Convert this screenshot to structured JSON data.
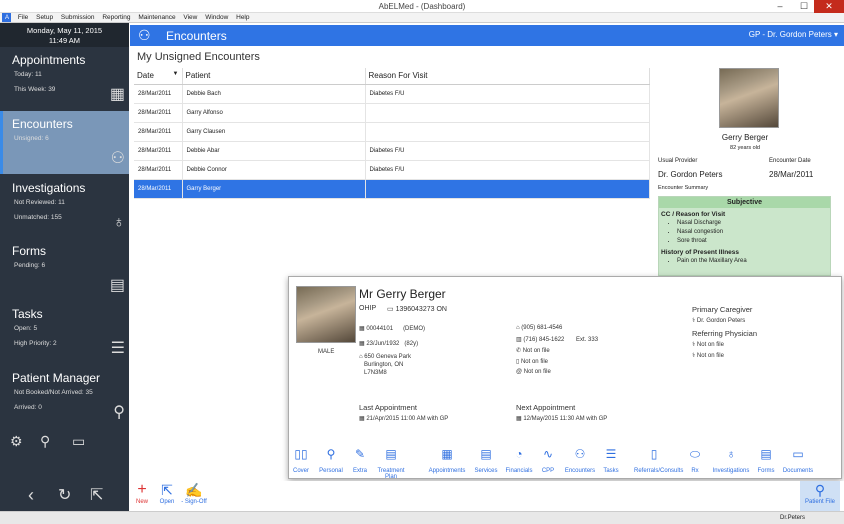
{
  "window": {
    "title": "AbELMed - (Dashboard)",
    "min": "‒",
    "max": "☐",
    "close": "✕"
  },
  "menu": [
    "File",
    "Setup",
    "Submission",
    "Reporting",
    "Maintenance",
    "View",
    "Window",
    "Help"
  ],
  "sidebar": {
    "date": "Monday, May 11, 2015",
    "time": "11:49 AM",
    "sections": [
      {
        "title": "Appointments",
        "l1": "Today: 11",
        "l2": "This Week: 39"
      },
      {
        "title": "Encounters",
        "l1": "Unsigned: 6",
        "l2": ""
      },
      {
        "title": "Investigations",
        "l1": "Not Reviewed: 11",
        "l2": "Unmatched: 155"
      },
      {
        "title": "Forms",
        "l1": "Pending: 6",
        "l2": ""
      },
      {
        "title": "Tasks",
        "l1": "Open: 5",
        "l2": "High Priority: 2"
      },
      {
        "title": "Patient Manager",
        "l1": "Not Booked/Not Arrived: 35",
        "l2": "Arrived: 0"
      }
    ]
  },
  "header": {
    "title": "Encounters",
    "provider": "GP - Dr. Gordon Peters"
  },
  "list": {
    "title": "My Unsigned Encounters",
    "columns": [
      "Date",
      "Patient",
      "Reason For Visit"
    ],
    "rows": [
      {
        "date": "28/Mar/2011",
        "patient": "Debbie Bach",
        "reason": "Diabetes F/U"
      },
      {
        "date": "28/Mar/2011",
        "patient": "Garry Alfonso",
        "reason": ""
      },
      {
        "date": "28/Mar/2011",
        "patient": "Garry Clausen",
        "reason": ""
      },
      {
        "date": "28/Mar/2011",
        "patient": "Debbie Abar",
        "reason": "Diabetes F/U"
      },
      {
        "date": "28/Mar/2011",
        "patient": "Debbie Connor",
        "reason": "Diabetes F/U"
      },
      {
        "date": "28/Mar/2011",
        "patient": "Garry Berger",
        "reason": ""
      }
    ]
  },
  "right": {
    "name": "Gerry Berger",
    "age": "82 years old",
    "usual_provider_label": "Usual Provider",
    "usual_provider": "Dr. Gordon Peters",
    "enc_date_label": "Encounter Date",
    "enc_date": "28/Mar/2011",
    "summary_label": "Encounter Summary",
    "subjective": "Subjective",
    "cc": "CC / Reason for Visit",
    "cc_items": [
      "Nasal Discharge",
      "Nasal congestion",
      "Sore throat"
    ],
    "hpi": "History of Present Illness",
    "hpi_items": [
      "Pain on the Maxillary Area"
    ]
  },
  "popup": {
    "name": "Mr Gerry Berger",
    "sex": "MALE",
    "ohip_label": "OHIP",
    "ohip": "1396043273 ON",
    "chart": "00044101",
    "chart_tag": "(DEMO)",
    "dob": "23/Jun/1932",
    "dob_tag": "(82y)",
    "addr1": "650 Geneva Park",
    "addr2": "Burlington, ON",
    "addr3": "L7N3M8",
    "phone1": "(905) 681-4546",
    "phone2": "(716) 845-1622",
    "ext": "Ext. 333",
    "phone3": "Not on file",
    "phone4": "Not on file",
    "email": "Not on file",
    "primary_label": "Primary Caregiver",
    "primary": "Dr. Gordon Peters",
    "ref_label": "Referring Physician",
    "ref1": "Not on file",
    "ref2": "Not on file",
    "last_label": "Last Appointment",
    "last": "21/Apr/2015 11:00 AM with GP",
    "next_label": "Next Appointment",
    "next": "12/May/2015 11:30 AM with GP",
    "nav": [
      "Cover",
      "Personal",
      "Extra",
      "Treatment Plan",
      "Appointments",
      "Services",
      "Financials",
      "CPP",
      "Encounters",
      "Tasks",
      "Referrals/Consults",
      "Rx",
      "Investigations",
      "Forms",
      "Documents"
    ]
  },
  "bottom": {
    "new": "New",
    "open": "Open",
    "signoff": "Sign-Off",
    "patient_file": "Patient File"
  },
  "status": {
    "user": "Dr.Peters"
  }
}
